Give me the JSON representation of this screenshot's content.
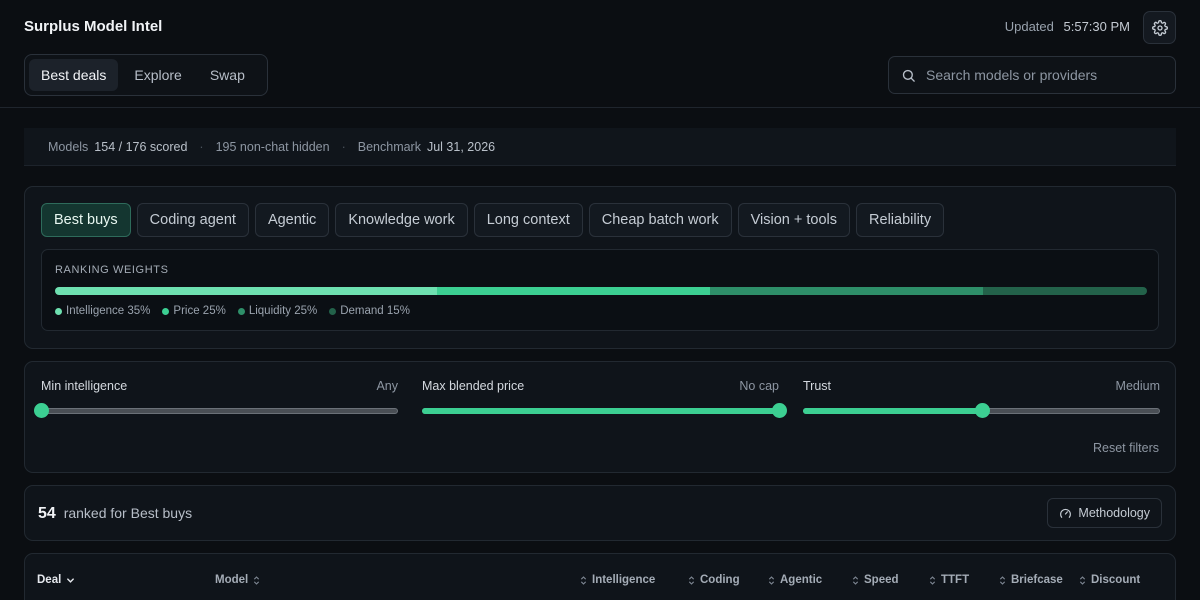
{
  "header": {
    "app_title": "Surplus Model Intel",
    "updated_label": "Updated",
    "updated_time": "5:57:30 PM",
    "nav_tabs": [
      {
        "label": "Best deals",
        "active": true
      },
      {
        "label": "Explore",
        "active": false
      },
      {
        "label": "Swap",
        "active": false
      }
    ],
    "search_placeholder": "Search models or providers"
  },
  "stats": {
    "models_label": "Models",
    "models_value": "154 / 176 scored",
    "hidden_text": "195 non-chat hidden",
    "benchmark_label": "Benchmark",
    "benchmark_value": "Jul 31, 2026"
  },
  "presets": [
    {
      "label": "Best buys",
      "active": true
    },
    {
      "label": "Coding agent",
      "active": false
    },
    {
      "label": "Agentic",
      "active": false
    },
    {
      "label": "Knowledge work",
      "active": false
    },
    {
      "label": "Long context",
      "active": false
    },
    {
      "label": "Cheap batch work",
      "active": false
    },
    {
      "label": "Vision + tools",
      "active": false
    },
    {
      "label": "Reliability",
      "active": false
    }
  ],
  "weights": {
    "title": "RANKING WEIGHTS",
    "items": [
      {
        "label": "Intelligence 35%",
        "pct": 35,
        "color": "#6ee0b0"
      },
      {
        "label": "Price 25%",
        "pct": 25,
        "color": "#3ccf92"
      },
      {
        "label": "Liquidity 25%",
        "pct": 25,
        "color": "#2e8f69"
      },
      {
        "label": "Demand 15%",
        "pct": 15,
        "color": "#23624a"
      }
    ]
  },
  "filters": [
    {
      "label": "Min intelligence",
      "value": "Any",
      "level": 0
    },
    {
      "label": "Max blended price",
      "value": "No cap",
      "level": 1
    },
    {
      "label": "Trust",
      "value": "Medium",
      "level": 0.5
    }
  ],
  "reset_label": "Reset filters",
  "results": {
    "count": "54",
    "label": "ranked for Best buys",
    "methodology_label": "Methodology"
  },
  "table": {
    "columns": [
      "Deal",
      "Model",
      "Intelligence",
      "Coding",
      "Agentic",
      "Speed",
      "TTFT",
      "Briefcase",
      "Discount"
    ]
  },
  "colors": {
    "accent": "#3ccf92",
    "background": "#0b0e12"
  }
}
